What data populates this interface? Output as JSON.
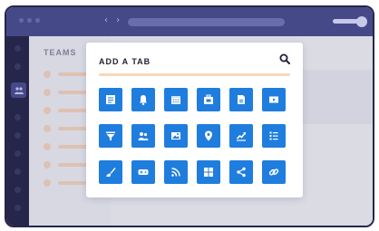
{
  "titlebar": {
    "nav_arrows": "‹ ›"
  },
  "sidebar": {
    "title": "TEAMS",
    "team_count": 7
  },
  "modal": {
    "title": "ADD A TAB",
    "tiles": [
      {
        "icon": "list-doc-icon"
      },
      {
        "icon": "bell-icon"
      },
      {
        "icon": "calendar-icon"
      },
      {
        "icon": "briefcase-icon"
      },
      {
        "icon": "document-icon"
      },
      {
        "icon": "video-icon"
      },
      {
        "icon": "filter-icon"
      },
      {
        "icon": "people-icon"
      },
      {
        "icon": "image-icon"
      },
      {
        "icon": "location-pin-icon"
      },
      {
        "icon": "line-chart-icon"
      },
      {
        "icon": "checklist-icon"
      },
      {
        "icon": "brush-icon"
      },
      {
        "icon": "game-controller-icon"
      },
      {
        "icon": "rss-icon"
      },
      {
        "icon": "grid-icon"
      },
      {
        "icon": "share-icon"
      },
      {
        "icon": "link-icon"
      }
    ]
  },
  "colors": {
    "titlebar": "#4a4e90",
    "rail": "#26264a",
    "tile": "#1f7dde",
    "accent_line": "#fbd7b6"
  }
}
